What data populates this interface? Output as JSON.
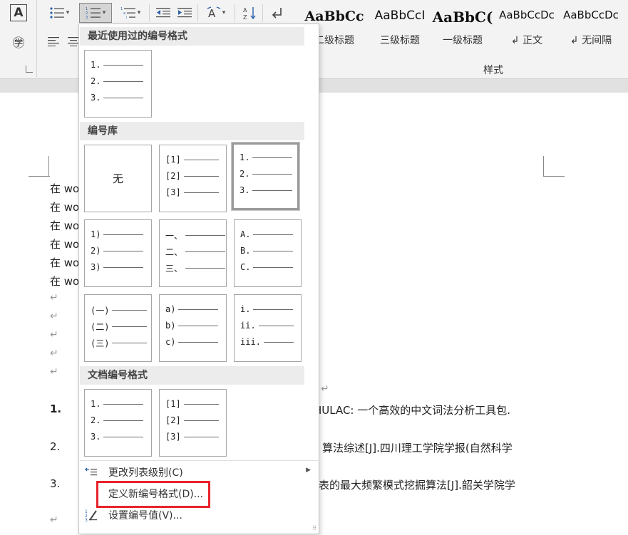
{
  "ribbon": {
    "style_samples": [
      {
        "sample": "AaBbCc",
        "name": "二级标题"
      },
      {
        "sample": "AaBbCcI",
        "name": "三级标题"
      },
      {
        "sample": "AaBbC(",
        "name": "一级标题"
      },
      {
        "sample": "AaBbCcDc",
        "name": "↲ 正文"
      },
      {
        "sample": "AaBbCcDc",
        "name": "↲ 无间隔"
      }
    ],
    "styles_group_label": "样式"
  },
  "document": {
    "lines": [
      "在 wo",
      "在 wo",
      "在 wo",
      "在 wo",
      "在 wo",
      "在 wo"
    ],
    "para_mark": "↵",
    "list": [
      {
        "num": "1.",
        "text": "HULAC: 一个高效的中文词法分析工具包."
      },
      {
        "num": "2.",
        "text": "算法综述[J].四川理工学院学报(自然科学"
      },
      {
        "num": "3.",
        "text": "表的最大频繁模式挖掘算法[J].韶关学院学"
      }
    ]
  },
  "dropdown": {
    "recent_header": "最近使用过的编号格式",
    "library_header": "编号库",
    "document_header": "文档编号格式",
    "none_label": "无",
    "recent_tiles": [
      {
        "labels": [
          "1.",
          "2.",
          "3."
        ]
      }
    ],
    "library_tiles": [
      {
        "labels": [
          "[1]",
          "[2]",
          "[3]"
        ]
      },
      {
        "labels": [
          "1.",
          "2.",
          "3."
        ],
        "selected": true
      },
      {
        "labels": [
          "1)",
          "2)",
          "3)"
        ]
      },
      {
        "labels": [
          "一、",
          "二、",
          "三、"
        ]
      },
      {
        "labels": [
          "A.",
          "B.",
          "C."
        ]
      },
      {
        "labels": [
          "(一)",
          "(二)",
          "(三)"
        ]
      },
      {
        "labels": [
          "a)",
          "b)",
          "c)"
        ]
      },
      {
        "labels": [
          "i.",
          "ii.",
          "iii."
        ]
      }
    ],
    "document_tiles": [
      {
        "labels": [
          "1.",
          "2.",
          "3."
        ]
      },
      {
        "labels": [
          "[1]",
          "[2]",
          "[3]"
        ]
      }
    ],
    "menu_items": [
      {
        "label": "更改列表级别(C)",
        "icon": "change-level-icon",
        "has_submenu": true
      },
      {
        "label": "定义新编号格式(D)...",
        "icon": "none"
      },
      {
        "label": "设置编号值(V)...",
        "icon": "set-number-value-icon"
      }
    ]
  }
}
